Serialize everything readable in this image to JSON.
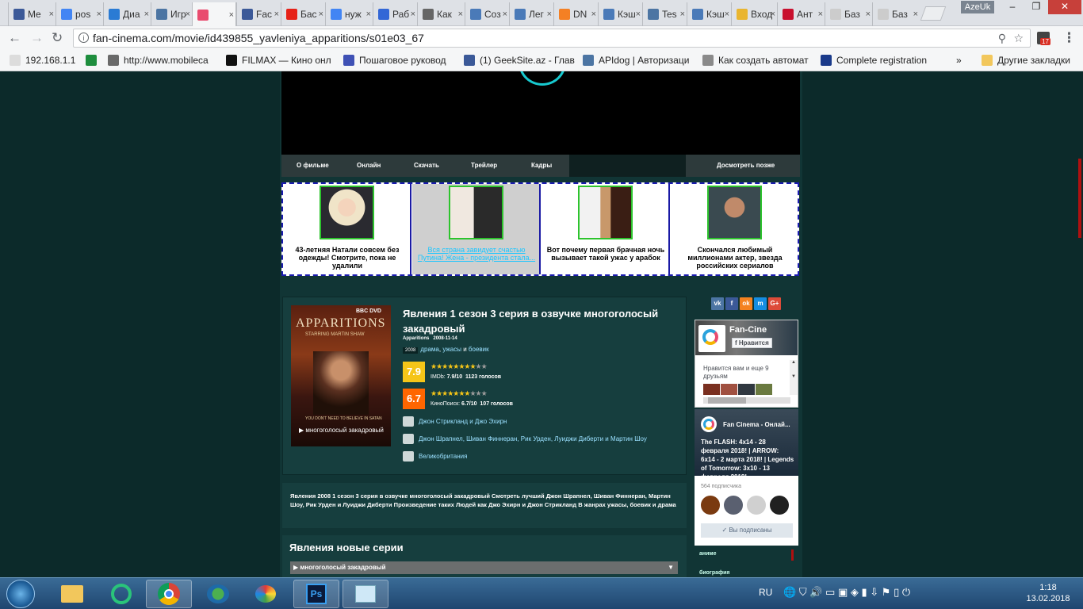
{
  "browser": {
    "tabs": [
      {
        "label": "Me",
        "icon": "facebook-icon",
        "color": "#3b5998"
      },
      {
        "label": "pos",
        "icon": "google-icon",
        "color": "#4285f4"
      },
      {
        "label": "Диа",
        "icon": "chat-icon",
        "color": "#2a7bd4"
      },
      {
        "label": "Игр",
        "icon": "vk-icon",
        "color": "#4c75a3"
      },
      {
        "label": "",
        "icon": "fan-cinema-icon",
        "color": "#e94c6f",
        "active": true
      },
      {
        "label": "Fac",
        "icon": "facebook-icon",
        "color": "#3b5998"
      },
      {
        "label": "Бас",
        "icon": "youtube-icon",
        "color": "#e62117"
      },
      {
        "label": "нуж",
        "icon": "google-icon",
        "color": "#4285f4"
      },
      {
        "label": "Раб",
        "icon": "search-icon",
        "color": "#3367d6"
      },
      {
        "label": "Как",
        "icon": "robot-icon",
        "color": "#666666"
      },
      {
        "label": "Соз",
        "icon": "database-icon",
        "color": "#4a7ab8"
      },
      {
        "label": "Лег",
        "icon": "database-icon",
        "color": "#4a7ab8"
      },
      {
        "label": "DN",
        "icon": "cloud-icon",
        "color": "#f48024"
      },
      {
        "label": "Кэш",
        "icon": "database-icon",
        "color": "#4a7ab8"
      },
      {
        "label": "Tes",
        "icon": "vk-icon",
        "color": "#4c75a3"
      },
      {
        "label": "Кэш",
        "icon": "database-icon",
        "color": "#4a7ab8"
      },
      {
        "label": "Вход",
        "icon": "mail-icon",
        "color": "#e9b52f"
      },
      {
        "label": "Ант",
        "icon": "kaspersky-icon",
        "color": "#c8102e"
      },
      {
        "label": "Баз",
        "icon": "page-icon",
        "color": "#cccccc"
      },
      {
        "label": "Баз",
        "icon": "page-icon",
        "color": "#cccccc"
      }
    ],
    "window_user": "AzeUk",
    "url": "fan-cinema.com/movie/id439855_yavleniya_apparitions/s01e03_67",
    "extension_badge": "17",
    "bookmarks": [
      {
        "label": "192.168.1.1",
        "icon": "page-icon"
      },
      {
        "label": "",
        "icon": "shield-icon"
      },
      {
        "label": "http://www.mobileca",
        "icon": "m-icon"
      },
      {
        "label": "FILMAX — Кино онл",
        "icon": "filmax-icon"
      },
      {
        "label": "Пошаговое руковод",
        "icon": "doc-icon"
      },
      {
        "label": "(1) GeekSite.az - Глав",
        "icon": "facebook-icon"
      },
      {
        "label": "APIdog | Авторизаци",
        "icon": "vk-icon"
      },
      {
        "label": "Как создать автомат",
        "icon": "robot-icon"
      },
      {
        "label": "Complete registration",
        "icon": "fx-icon"
      },
      {
        "label": "»",
        "icon": ""
      },
      {
        "label": "Другие закладки",
        "icon": "folder-icon"
      }
    ]
  },
  "player": {
    "tabs": [
      "О фильме",
      "Онлайн",
      "Скачать",
      "Трейлер",
      "Кадры"
    ],
    "later": "Досмотреть позже"
  },
  "ads": [
    {
      "text": "43-летняя Натали совсем без одежды! Смотрите, пока не удалили",
      "link": false
    },
    {
      "text": "Вся страна завидует счастью Путина! Жена - президента стала...",
      "link": true
    },
    {
      "text": "Вот почему первая брачная ночь вызывает такой ужас у арабок",
      "link": false
    },
    {
      "text": "Скончался любимый миллионами актер, звезда российских сериалов",
      "link": false
    }
  ],
  "movie": {
    "poster_title": "APPARITIONS",
    "poster_subtitle": "STARRING MARTIN SHAW",
    "poster_badge": "BBC DVD",
    "poster_caption": "YOU DON'T NEED TO BELIEVE IN SATAN",
    "poster_voice": "многоголосый закадровый",
    "title": "Явления 1 сезон 3 серия в озвучке многоголосый закадровый",
    "original": "Apparitions",
    "date": "2008-11-14",
    "year": "2008",
    "genres_a": "драма",
    "genres_sep1": ",",
    "genres_b": "ужасы",
    "genres_and": "и",
    "genres_c": "боевик",
    "imdb": {
      "score": "7.9",
      "label": "IMDb:",
      "value": "7.9/10",
      "votes": "1123 голосов",
      "stars": "★★★★★★★★",
      "stars_empty": "★★",
      "color": "#f5c518"
    },
    "kp": {
      "score": "6.7",
      "label": "КиноПоиск:",
      "value": "6.7/10",
      "votes": "107 голосов",
      "stars": "★★★★★★★",
      "stars_empty": "★★★",
      "color": "#ff6600"
    },
    "directors": "Джон Стрикланд и Джо Эхирн",
    "actors": "Джон Шрапнел, Шиван Финнеран, Рик Урден, Луиджи Диберти и Мартин Шоу",
    "country": "Великобритания"
  },
  "description": "Явления 2008 1 сезон 3 серия в озвучке многоголосый закадровый Смотреть лучший Джон Шрапнел, Шиван Финнеран, Мартин Шоу, Рик Урден и Луиджи Диберти Произведение таких Людей как Джо Эхирн и Джон Стрикланд В жанрах ужасы, боевик и драма",
  "news": {
    "title": "Явления новые серии",
    "select": "▶ многоголосый закадровый"
  },
  "sidebar": {
    "social": [
      "vk",
      "f",
      "ok",
      "m",
      "G+"
    ],
    "fb_title": "Fan-Cine",
    "fb_like": "Нравится",
    "fb_friends": "Нравится вам и еще 9 друзьям",
    "vk_title": "Fan Cinema - Онлай...",
    "vk_post": "The FLASH: 4x14 - 28 февраля 2018! | ARROW: 6x14 - 2 марта 2018! | Legends of Tomorrow: 3x10 - 13 февраля 2018!",
    "vk_subs": "564 подписчика",
    "vk_subscribed": "Вы подписаны",
    "menu": [
      "аниме",
      "биография"
    ]
  },
  "taskbar": {
    "lang": "RU",
    "time": "1:18",
    "date": "13.02.2018"
  }
}
